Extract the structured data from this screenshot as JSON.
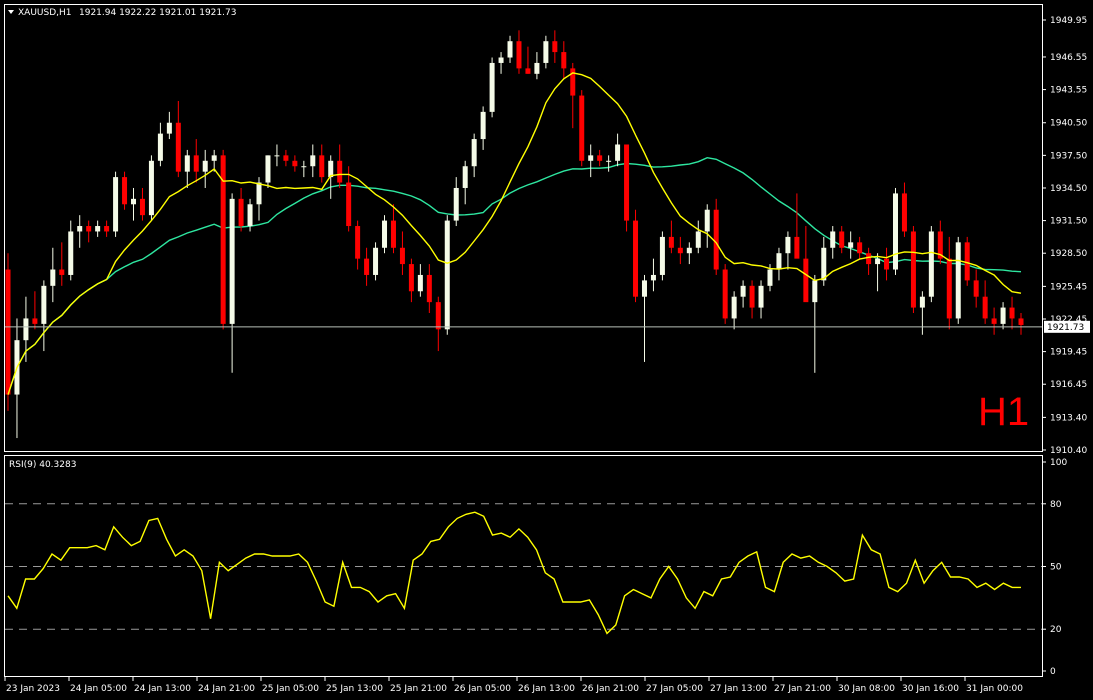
{
  "header": {
    "symbol": "XAUUSD,H1",
    "ohlc": "1921.94 1922.22 1921.01 1921.73"
  },
  "timeframe_label": "H1",
  "current_price_label": "1921.73",
  "rsi_panel": {
    "label": "RSI(9) 40.3283",
    "levels": [
      80,
      50,
      20
    ],
    "ticks": [
      100,
      80,
      50,
      20,
      0
    ]
  },
  "colors": {
    "background": "#000000",
    "frame": "#ffffff",
    "bull_candle": "#f5fbe8",
    "bear_candle": "#ff0000",
    "ma_fast": "#ffff00",
    "ma_slow": "#2ee6a0",
    "rsi_line": "#ffff00",
    "grid_dash": "#9a9a9a"
  },
  "chart_data": [
    {
      "type": "candlestick",
      "title": "XAUUSD,H1",
      "price_ticks": [
        1949.95,
        1946.55,
        1943.55,
        1940.5,
        1937.5,
        1934.5,
        1931.5,
        1928.5,
        1925.45,
        1922.45,
        1919.45,
        1916.45,
        1913.4,
        1910.4
      ],
      "ylim": [
        1910.4,
        1951.5
      ],
      "x_labels": [
        "23 Jan 2023",
        "24 Jan 05:00",
        "24 Jan 13:00",
        "24 Jan 21:00",
        "25 Jan 05:00",
        "25 Jan 13:00",
        "25 Jan 21:00",
        "26 Jan 05:00",
        "26 Jan 13:00",
        "26 Jan 21:00",
        "27 Jan 05:00",
        "27 Jan 13:00",
        "27 Jan 21:00",
        "30 Jan 08:00",
        "30 Jan 16:00",
        "31 Jan 00:00"
      ],
      "current_price": 1921.73,
      "candles": [
        [
          1927.0,
          1928.5,
          1914.0,
          1915.5
        ],
        [
          1915.5,
          1922.5,
          1911.5,
          1920.5
        ],
        [
          1920.5,
          1924.5,
          1918.5,
          1922.5
        ],
        [
          1922.5,
          1925.0,
          1921.5,
          1922.0
        ],
        [
          1922.0,
          1926.0,
          1919.5,
          1925.5
        ],
        [
          1925.5,
          1929.0,
          1924.0,
          1927.0
        ],
        [
          1927.0,
          1929.5,
          1925.5,
          1926.5
        ],
        [
          1926.5,
          1931.5,
          1926.0,
          1930.5
        ],
        [
          1930.5,
          1932.0,
          1929.0,
          1931.0
        ],
        [
          1931.0,
          1931.5,
          1929.5,
          1930.5
        ],
        [
          1930.5,
          1931.5,
          1930.0,
          1931.0
        ],
        [
          1931.0,
          1931.5,
          1930.0,
          1930.5
        ],
        [
          1930.5,
          1936.0,
          1930.0,
          1935.5
        ],
        [
          1935.5,
          1936.0,
          1932.5,
          1933.0
        ],
        [
          1933.0,
          1934.5,
          1931.5,
          1933.5
        ],
        [
          1933.5,
          1934.5,
          1931.5,
          1932.0
        ],
        [
          1932.0,
          1937.5,
          1931.5,
          1937.0
        ],
        [
          1937.0,
          1940.5,
          1936.5,
          1939.5
        ],
        [
          1939.5,
          1941.5,
          1939.0,
          1940.5
        ],
        [
          1940.5,
          1942.5,
          1935.5,
          1936.0
        ],
        [
          1936.0,
          1938.0,
          1934.5,
          1937.5
        ],
        [
          1937.5,
          1939.0,
          1935.0,
          1936.0
        ],
        [
          1936.0,
          1938.0,
          1934.5,
          1937.0
        ],
        [
          1937.0,
          1938.0,
          1936.0,
          1937.5
        ],
        [
          1937.5,
          1938.0,
          1921.5,
          1922.0
        ],
        [
          1922.0,
          1934.0,
          1917.5,
          1933.5
        ],
        [
          1933.5,
          1934.5,
          1930.5,
          1931.0
        ],
        [
          1931.0,
          1933.5,
          1930.5,
          1933.0
        ],
        [
          1933.0,
          1935.5,
          1931.5,
          1935.0
        ],
        [
          1935.0,
          1937.5,
          1934.5,
          1937.5
        ],
        [
          1937.5,
          1938.5,
          1936.5,
          1937.5
        ],
        [
          1937.5,
          1938.0,
          1936.5,
          1937.0
        ],
        [
          1937.0,
          1937.5,
          1936.0,
          1936.5
        ],
        [
          1936.5,
          1937.0,
          1935.5,
          1936.5
        ],
        [
          1936.5,
          1938.5,
          1935.5,
          1937.5
        ],
        [
          1937.5,
          1938.5,
          1935.0,
          1935.5
        ],
        [
          1935.5,
          1937.5,
          1933.5,
          1937.0
        ],
        [
          1937.0,
          1938.5,
          1934.5,
          1935.0
        ],
        [
          1935.0,
          1936.5,
          1930.5,
          1931.0
        ],
        [
          1931.0,
          1931.5,
          1927.0,
          1928.0
        ],
        [
          1928.0,
          1929.0,
          1925.5,
          1926.5
        ],
        [
          1926.5,
          1929.5,
          1926.0,
          1929.0
        ],
        [
          1929.0,
          1932.0,
          1928.5,
          1931.5
        ],
        [
          1931.5,
          1933.0,
          1928.5,
          1929.0
        ],
        [
          1929.0,
          1930.5,
          1926.5,
          1927.5
        ],
        [
          1927.5,
          1928.0,
          1924.0,
          1925.0
        ],
        [
          1925.0,
          1927.5,
          1924.5,
          1926.5
        ],
        [
          1926.5,
          1927.5,
          1923.0,
          1924.0
        ],
        [
          1924.0,
          1924.5,
          1919.5,
          1921.5
        ],
        [
          1921.5,
          1932.0,
          1921.0,
          1931.5
        ],
        [
          1931.5,
          1935.5,
          1931.0,
          1934.5
        ],
        [
          1934.5,
          1937.0,
          1933.0,
          1936.5
        ],
        [
          1936.5,
          1939.5,
          1935.5,
          1939.0
        ],
        [
          1939.0,
          1942.0,
          1938.0,
          1941.5
        ],
        [
          1941.5,
          1946.5,
          1941.0,
          1946.0
        ],
        [
          1946.0,
          1947.0,
          1945.0,
          1946.5
        ],
        [
          1946.5,
          1948.5,
          1946.0,
          1948.0
        ],
        [
          1948.0,
          1949.0,
          1945.0,
          1945.5
        ],
        [
          1945.5,
          1947.5,
          1945.0,
          1945.0
        ],
        [
          1945.0,
          1947.0,
          1944.5,
          1946.0
        ],
        [
          1946.0,
          1948.5,
          1945.5,
          1948.0
        ],
        [
          1948.0,
          1949.0,
          1946.0,
          1947.0
        ],
        [
          1947.0,
          1948.0,
          1944.5,
          1945.5
        ],
        [
          1945.5,
          1946.0,
          1940.0,
          1943.0
        ],
        [
          1943.0,
          1943.5,
          1936.5,
          1937.0
        ],
        [
          1937.0,
          1938.5,
          1935.5,
          1937.5
        ],
        [
          1937.5,
          1938.0,
          1936.5,
          1937.0
        ],
        [
          1937.0,
          1937.5,
          1936.0,
          1937.0
        ],
        [
          1937.0,
          1939.5,
          1936.5,
          1938.5
        ],
        [
          1938.5,
          1938.5,
          1930.5,
          1931.5
        ],
        [
          1931.5,
          1932.5,
          1924.0,
          1924.5
        ],
        [
          1924.5,
          1926.5,
          1918.5,
          1926.0
        ],
        [
          1926.0,
          1928.0,
          1925.0,
          1926.5
        ],
        [
          1926.5,
          1930.5,
          1926.0,
          1930.0
        ],
        [
          1930.0,
          1931.5,
          1928.5,
          1929.0
        ],
        [
          1929.0,
          1930.0,
          1927.5,
          1928.5
        ],
        [
          1928.5,
          1929.5,
          1927.5,
          1929.0
        ],
        [
          1929.0,
          1931.5,
          1928.5,
          1930.5
        ],
        [
          1930.5,
          1933.0,
          1929.0,
          1932.5
        ],
        [
          1932.5,
          1933.5,
          1926.5,
          1927.0
        ],
        [
          1927.0,
          1927.5,
          1922.0,
          1922.5
        ],
        [
          1922.5,
          1925.0,
          1921.5,
          1924.5
        ],
        [
          1924.5,
          1926.0,
          1923.5,
          1925.5
        ],
        [
          1925.5,
          1926.0,
          1922.5,
          1923.5
        ],
        [
          1923.5,
          1926.0,
          1922.5,
          1925.5
        ],
        [
          1925.5,
          1927.5,
          1925.0,
          1927.0
        ],
        [
          1927.0,
          1929.0,
          1926.0,
          1928.5
        ],
        [
          1928.5,
          1930.5,
          1927.0,
          1930.0
        ],
        [
          1930.0,
          1934.0,
          1929.5,
          1928.0
        ],
        [
          1928.0,
          1931.0,
          1926.0,
          1924.0
        ],
        [
          1924.0,
          1926.5,
          1917.5,
          1926.0
        ],
        [
          1926.0,
          1930.0,
          1925.5,
          1929.0
        ],
        [
          1929.0,
          1931.0,
          1928.0,
          1930.5
        ],
        [
          1930.5,
          1931.0,
          1928.5,
          1929.0
        ],
        [
          1929.0,
          1930.5,
          1928.0,
          1929.5
        ],
        [
          1929.5,
          1930.0,
          1928.0,
          1928.5
        ],
        [
          1928.5,
          1929.0,
          1926.5,
          1927.5
        ],
        [
          1927.5,
          1928.5,
          1925.0,
          1928.0
        ],
        [
          1928.0,
          1929.0,
          1926.0,
          1927.0
        ],
        [
          1927.0,
          1934.5,
          1926.5,
          1934.0
        ],
        [
          1934.0,
          1935.0,
          1930.0,
          1930.5
        ],
        [
          1930.5,
          1931.0,
          1923.0,
          1923.5
        ],
        [
          1923.5,
          1925.0,
          1921.0,
          1924.5
        ],
        [
          1924.5,
          1931.0,
          1924.0,
          1930.5
        ],
        [
          1930.5,
          1931.5,
          1927.5,
          1928.0
        ],
        [
          1928.0,
          1930.0,
          1921.5,
          1922.5
        ],
        [
          1922.5,
          1930.0,
          1922.0,
          1929.5
        ],
        [
          1929.5,
          1930.0,
          1925.5,
          1926.0
        ],
        [
          1926.0,
          1927.0,
          1923.5,
          1924.5
        ],
        [
          1924.5,
          1926.0,
          1922.0,
          1922.5
        ],
        [
          1922.5,
          1923.5,
          1921.0,
          1922.0
        ],
        [
          1922.0,
          1924.0,
          1921.5,
          1923.5
        ],
        [
          1923.5,
          1924.5,
          1921.5,
          1922.5
        ],
        [
          1922.5,
          1923.0,
          1921.0,
          1921.9
        ]
      ]
    },
    {
      "type": "line",
      "title": "RSI(9) 40.3283",
      "ylim": [
        0,
        100
      ],
      "levels": [
        80,
        50,
        20
      ],
      "values": [
        36,
        30,
        44,
        44,
        49,
        56,
        53,
        59,
        59,
        59,
        60,
        58,
        69,
        64,
        60,
        62,
        72,
        73,
        63,
        55,
        58,
        55,
        48,
        25,
        52,
        48,
        51,
        54,
        56,
        56,
        55,
        55,
        55,
        56,
        52,
        43,
        33,
        31,
        52,
        40,
        40,
        38,
        33,
        36,
        37,
        30,
        53,
        56,
        62,
        63,
        69,
        73,
        75,
        76,
        74,
        65,
        66,
        64,
        68,
        64,
        58,
        47,
        44,
        33,
        33,
        33,
        34,
        27,
        18,
        22,
        36,
        39,
        37,
        35,
        44,
        50,
        44,
        35,
        30,
        38,
        36,
        44,
        45,
        52,
        55,
        57,
        40,
        38,
        52,
        56,
        54,
        55,
        52,
        50,
        47,
        43,
        44,
        65,
        58,
        56,
        40,
        38,
        42,
        53,
        42,
        48,
        52,
        45,
        45,
        44,
        40,
        42,
        39,
        42,
        40,
        40
      ]
    }
  ]
}
